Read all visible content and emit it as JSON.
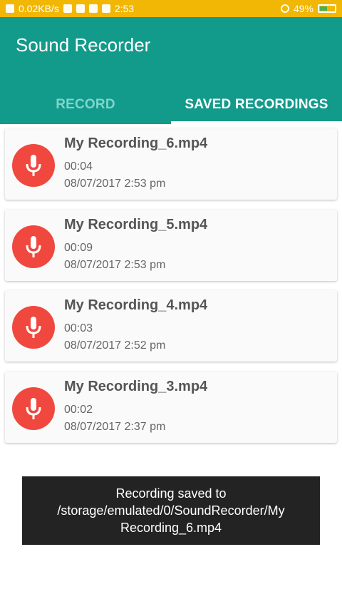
{
  "status_bar": {
    "speed": "0.02KB/s",
    "time": "2:53",
    "battery": "49%"
  },
  "app": {
    "title": "Sound Recorder"
  },
  "tabs": [
    {
      "label": "RECORD",
      "active": false
    },
    {
      "label": "SAVED RECORDINGS",
      "active": true
    }
  ],
  "recordings": [
    {
      "name": "My Recording_6.mp4",
      "duration": "00:04",
      "date": "08/07/2017 2:53 pm"
    },
    {
      "name": "My Recording_5.mp4",
      "duration": "00:09",
      "date": "08/07/2017 2:53 pm"
    },
    {
      "name": "My Recording_4.mp4",
      "duration": "00:03",
      "date": "08/07/2017 2:52 pm"
    },
    {
      "name": "My Recording_3.mp4",
      "duration": "00:02",
      "date": "08/07/2017 2:37 pm"
    }
  ],
  "toast": {
    "message": "Recording saved to /storage/emulated/0/SoundRecorder/My Recording_6.mp4"
  },
  "colors": {
    "status_bar": "#f2b705",
    "primary": "#129a8b",
    "mic_button": "#f0483e"
  }
}
